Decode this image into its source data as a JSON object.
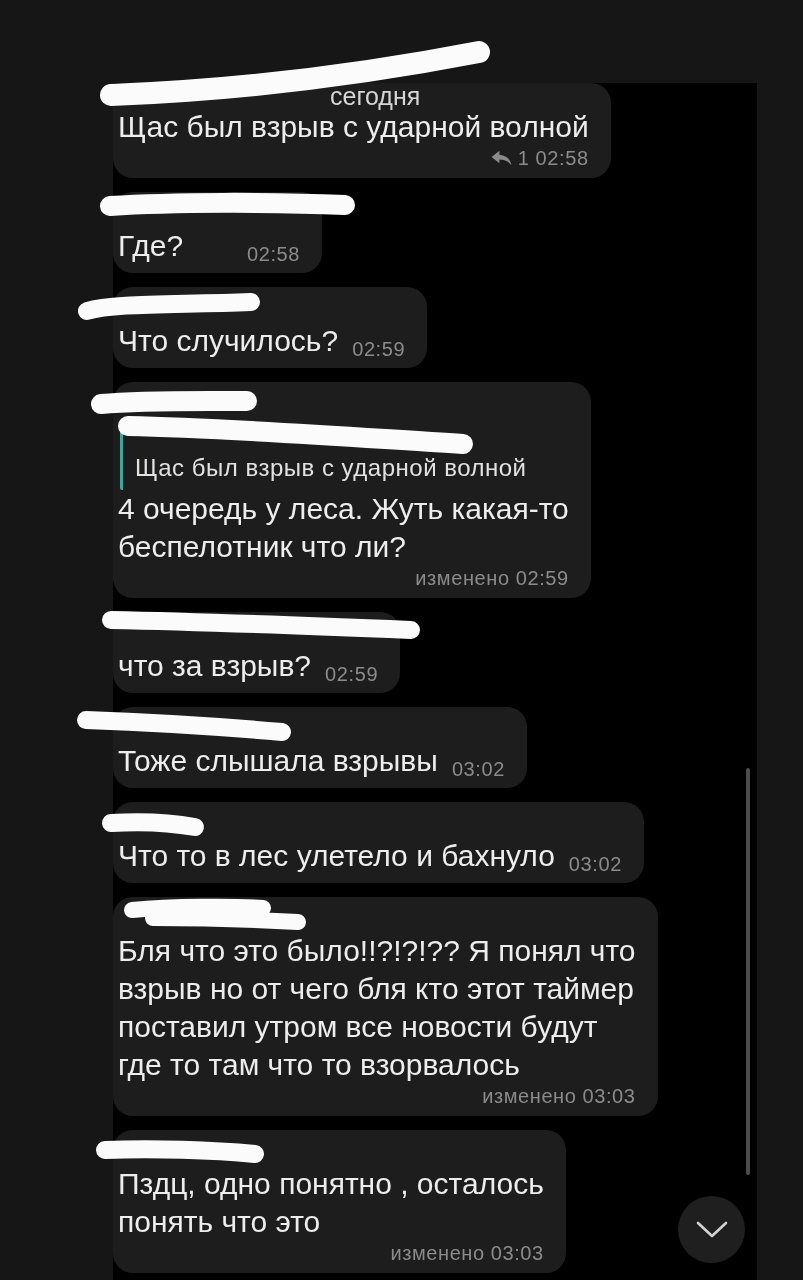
{
  "messages": [
    {
      "sender_redacted": true,
      "author": "сегодня",
      "text": "Щас был взрыв с ударной волной",
      "replies": "1",
      "time": "02:58",
      "meta_own_line": true
    },
    {
      "sender_redacted": true,
      "text": "Где?",
      "time": "02:58",
      "meta_own_line": false
    },
    {
      "sender_redacted": true,
      "text": "Что случилось?",
      "time": "02:59",
      "meta_own_line": false
    },
    {
      "sender_redacted": true,
      "quote": {
        "sender_redacted": true,
        "text": "Щас был взрыв с ударной волной"
      },
      "text": "4 очередь у леса. Жуть какая-то\nбеспелотник что ли?",
      "edited": "изменено",
      "time": "02:59",
      "meta_own_line": true
    },
    {
      "sender_redacted": true,
      "text": "что за взрыв?",
      "time": "02:59",
      "meta_own_line": false
    },
    {
      "sender_redacted": true,
      "text": "Тоже слышала взрывы",
      "time": "03:02",
      "meta_own_line": false
    },
    {
      "sender_redacted": true,
      "text": "Что то в лес улетело и бахнуло",
      "time": "03:02",
      "meta_own_line": false
    },
    {
      "sender_redacted": true,
      "text": "Бля что это было!!?!?!?? Я понял что\nвзрыв но от чего бля кто этот таймер\nпоставил утром все новости будут\nгде то там что то взорвалось",
      "edited": "изменено",
      "time": "03:03",
      "meta_own_line": true
    },
    {
      "sender_redacted": true,
      "text": "Пздц, одно понятно , осталось\nпонять что это",
      "edited": "изменено",
      "time": "03:03",
      "meta_own_line": true
    }
  ]
}
